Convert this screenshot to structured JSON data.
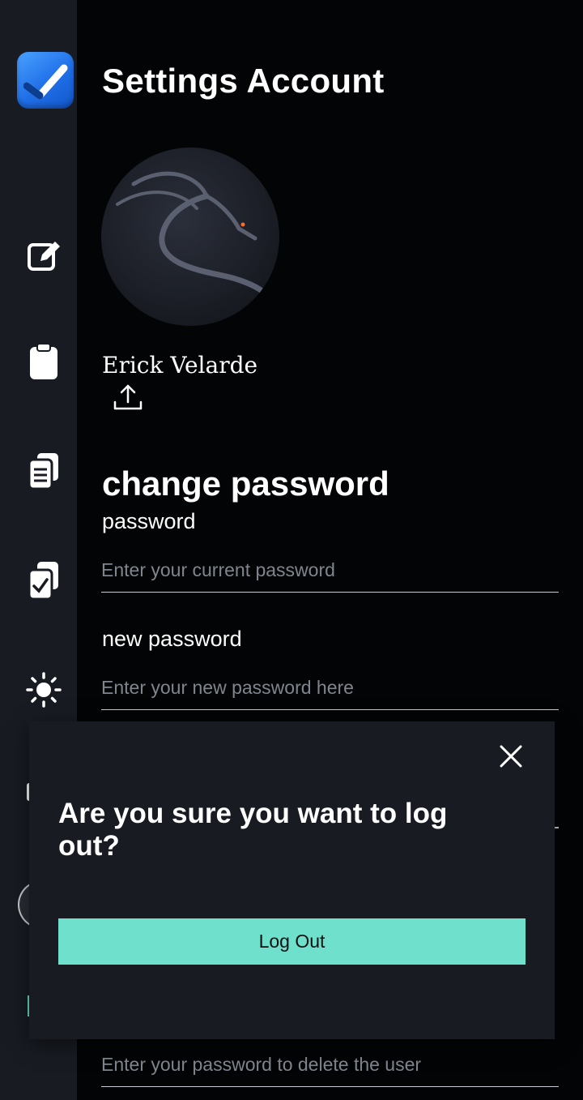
{
  "header": {
    "title": "Settings Account"
  },
  "profile": {
    "name": "Erick Velarde"
  },
  "change_password": {
    "title": "change password",
    "current_label": "password",
    "current_placeholder": "Enter your current password",
    "new_label": "new password",
    "new_placeholder": "Enter your new password here"
  },
  "delete_user": {
    "placeholder": "Enter your password to delete the user"
  },
  "logout_dialog": {
    "message": "Are you sure you want to log out?",
    "confirm_label": "Log Out"
  },
  "colors": {
    "sidebar": "#181b22",
    "background": "#030406",
    "accent": "#6ee0cc",
    "logo_blue": "#2f86f6"
  },
  "icons": [
    "check-logo-icon",
    "edit-icon",
    "clipboard-icon",
    "task-list-icon",
    "task-check-icon",
    "sun-icon",
    "upload-icon",
    "close-icon"
  ]
}
